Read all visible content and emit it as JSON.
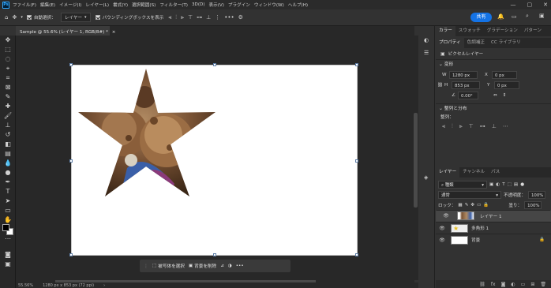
{
  "menubar": {
    "logo": "Ps",
    "items": [
      "ファイル(F)",
      "編集(E)",
      "イメージ(I)",
      "レイヤー(L)",
      "書式(Y)",
      "選択範囲(S)",
      "フィルター(T)",
      "3D(D)",
      "表示(V)",
      "プラグイン",
      "ウィンドウ(W)",
      "ヘルプ(H)"
    ],
    "controls": [
      "—",
      "▢",
      "✕"
    ]
  },
  "options": {
    "auto_select_label": "自動選択：",
    "auto_select_value": "レイヤー",
    "bbox_label": "バウンディングボックスを表示",
    "more": "•••",
    "share": "共有"
  },
  "document": {
    "tab_title": "Sample @ 55.6% (レイヤー 1, RGB/8#) *",
    "tab_close": "×"
  },
  "context_bar": {
    "select_subject": "被写体を選択",
    "remove_bg": "背景を削除",
    "more": "•••"
  },
  "status": {
    "zoom": "55.56%",
    "size": "1280 px x 853 px (72 ppi)"
  },
  "top_panel": {
    "tabs": [
      "カラー",
      "スウォッチ",
      "グラデーション",
      "パターン"
    ]
  },
  "properties": {
    "tabs": [
      "プロパティ",
      "色調補正",
      "CC ライブラリ"
    ],
    "type": "ピクセルレイヤー",
    "transform_title": "変形",
    "w_label": "W",
    "w_value": "1280 px",
    "x_label": "X",
    "x_value": "0 px",
    "h_label": "H",
    "h_value": "853 px",
    "y_label": "Y",
    "y_value": "0 px",
    "angle_value": "0.00°",
    "align_title": "整列と分布",
    "align_label": "整列："
  },
  "layers": {
    "tabs": [
      "レイヤー",
      "チャンネル",
      "パス"
    ],
    "filter_label": "種類",
    "blend_mode": "通常",
    "opacity_label": "不透明度：",
    "opacity_value": "100%",
    "lock_label": "ロック：",
    "fill_label": "塗り：",
    "fill_value": "100%",
    "items": [
      {
        "name": "レイヤー 1"
      },
      {
        "name": "多角形 1"
      },
      {
        "name": "背景"
      }
    ]
  },
  "colors": {
    "accent": "#1473e6",
    "panel_bg": "#323232",
    "canvas_bg": "#282828",
    "selected_layer": "#464646"
  }
}
